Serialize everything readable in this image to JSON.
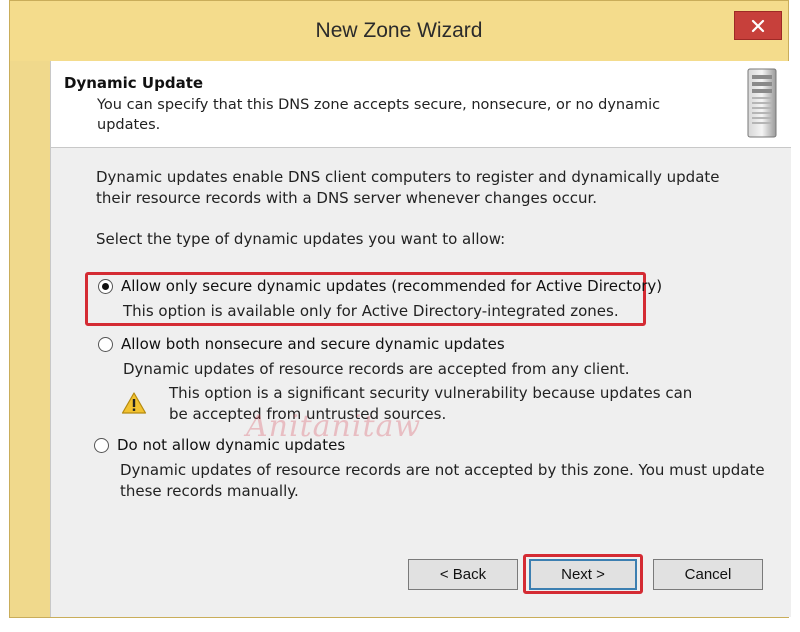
{
  "window": {
    "title": "New Zone Wizard"
  },
  "header": {
    "title": "Dynamic Update",
    "subtitle": "You can specify that this DNS zone accepts secure, nonsecure, or no dynamic updates."
  },
  "body": {
    "intro": "Dynamic updates enable DNS client computers to register and dynamically update their resource records with a DNS server whenever changes occur.",
    "prompt": "Select the type of dynamic updates you want to allow:"
  },
  "options": [
    {
      "label": "Allow only secure dynamic updates (recommended for Active Directory)",
      "description": "This option is available only for Active Directory-integrated zones.",
      "selected": true
    },
    {
      "label": "Allow both nonsecure and secure dynamic updates",
      "description": "Dynamic updates of resource records are accepted from any client.",
      "warning": "This option is a significant security vulnerability because updates can be accepted from untrusted sources.",
      "selected": false
    },
    {
      "label": "Do not allow dynamic updates",
      "description": "Dynamic updates of resource records are not accepted by this zone. You must update these records manually.",
      "selected": false
    }
  ],
  "watermark": "Anitanitaw",
  "buttons": {
    "back": "< Back",
    "next": "Next >",
    "cancel": "Cancel"
  },
  "icons": {
    "close": "close-icon",
    "server": "server-icon",
    "warning": "warning-icon"
  },
  "colors": {
    "highlight": "#d42b33",
    "titlebar": "#f4dc8c",
    "close": "#c7403b"
  }
}
